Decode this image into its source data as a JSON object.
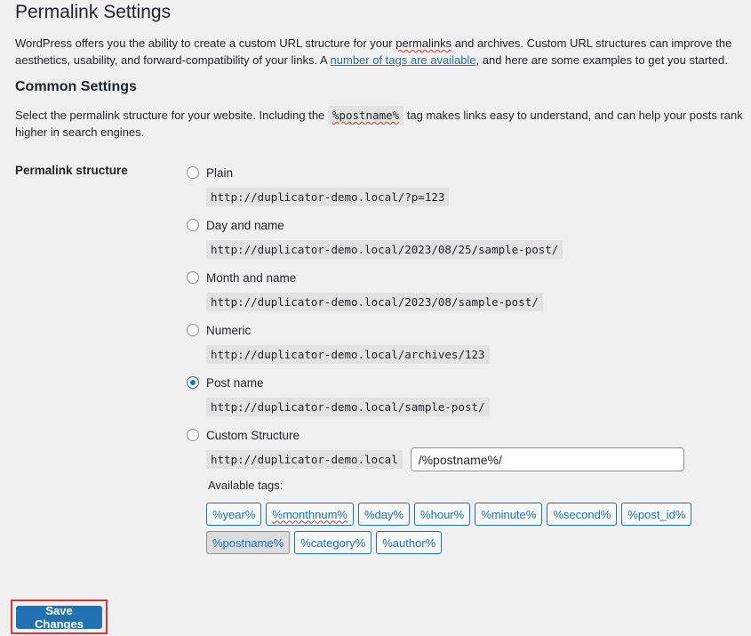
{
  "page": {
    "title": "Permalink Settings",
    "intro": {
      "before": "WordPress offers you the ability to create a custom URL structure for your ",
      "squiggle_word": "permalinks",
      "middle": " and archives. Custom URL structures can improve the aesthetics, usability, and forward-compatibility of your links. A ",
      "link_text": "number of tags are available",
      "after": ", and here are some examples to get you started."
    }
  },
  "common": {
    "heading": "Common Settings",
    "desc_before": "Select the permalink structure for your website. Including the ",
    "desc_code": "%postname%",
    "desc_after": " tag makes links easy to understand, and can help your posts rank higher in search engines."
  },
  "permalink": {
    "label": "Permalink structure",
    "options": [
      {
        "label": "Plain",
        "example": "http://duplicator-demo.local/?p=123",
        "checked": false
      },
      {
        "label": "Day and name",
        "example": "http://duplicator-demo.local/2023/08/25/sample-post/",
        "checked": false
      },
      {
        "label": "Month and name",
        "example": "http://duplicator-demo.local/2023/08/sample-post/",
        "checked": false
      },
      {
        "label": "Numeric",
        "example": "http://duplicator-demo.local/archives/123",
        "checked": false
      },
      {
        "label": "Post name",
        "example": "http://duplicator-demo.local/sample-post/",
        "checked": true
      },
      {
        "label": "Custom Structure",
        "example": "",
        "checked": false
      }
    ],
    "custom_base": "http://duplicator-demo.local",
    "custom_value": "/%postname%/",
    "available_tags_label": "Available tags:",
    "tags_row1": [
      "%year%",
      "%monthnum%",
      "%day%",
      "%hour%",
      "%minute%",
      "%second%",
      "%post_id%"
    ],
    "tags_row2": [
      "%postname%",
      "%category%",
      "%author%"
    ]
  },
  "save_label": "Save Changes",
  "colors": {
    "accent": "#2271b1",
    "highlight_box": "#d63638"
  }
}
